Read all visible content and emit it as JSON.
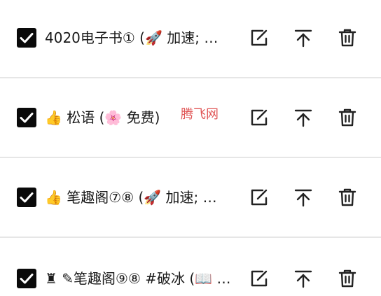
{
  "items": [
    {
      "label": "4020电子书① (🚀 加速; …",
      "checked": true
    },
    {
      "label": "👍 松语 (🌸 免费)",
      "checked": true
    },
    {
      "label": "👍 笔趣阁⑦⑧ (🚀 加速; …",
      "checked": true
    },
    {
      "label": "♜ ✎笔趣阁⑨⑧ #破冰 (📖 …",
      "checked": true
    }
  ],
  "icons": {
    "checkbox": "checkbox-checked-icon",
    "edit": "edit-icon",
    "move_top": "arrow-to-top-icon",
    "delete": "trash-icon"
  },
  "watermark": "腾飞网",
  "colors": {
    "checkbox_fill": "#0a0a0a",
    "icon_stroke": "#222222",
    "divider": "#e6e6e6",
    "watermark": "#e05555"
  }
}
